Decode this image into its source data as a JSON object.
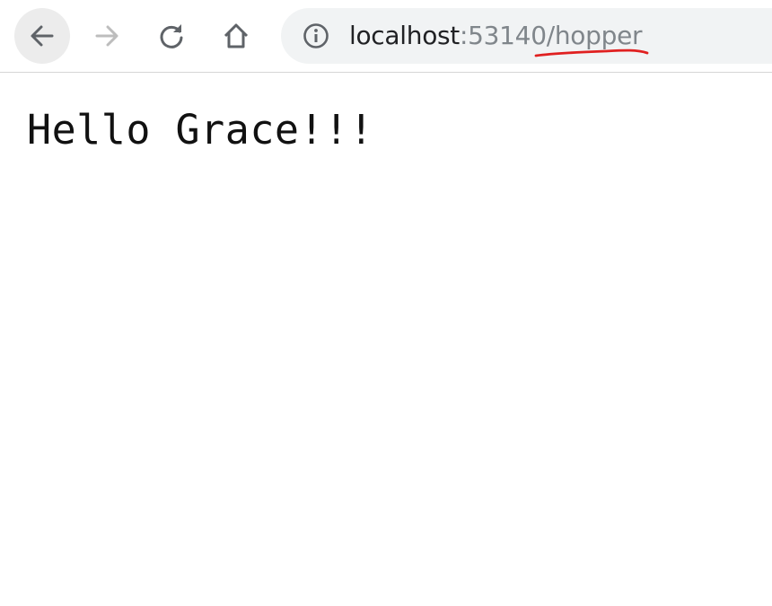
{
  "browser": {
    "toolbar": {
      "back_icon": "arrow-left-icon",
      "forward_icon": "arrow-right-icon",
      "reload_icon": "reload-icon",
      "home_icon": "home-icon"
    },
    "address_bar": {
      "info_icon": "info-icon",
      "host": "localhost",
      "port_and_path": ":53140/hopper",
      "annotation_color": "#e02020"
    }
  },
  "page": {
    "body_text": "Hello Grace!!!"
  }
}
